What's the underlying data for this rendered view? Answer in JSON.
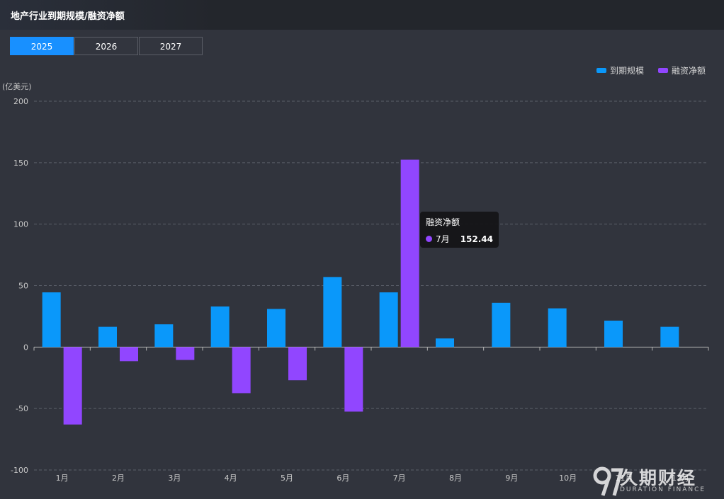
{
  "header": {
    "title": "地产行业到期规模/融资净额"
  },
  "tabs": [
    {
      "label": "2025",
      "active": true
    },
    {
      "label": "2026",
      "active": false
    },
    {
      "label": "2027",
      "active": false
    }
  ],
  "tooltip": {
    "series": "融资净额",
    "category": "7月",
    "value": "152.44"
  },
  "watermark": {
    "cn": "久期财经",
    "en": "DURATION FINANCE"
  },
  "colors": {
    "maturity": "#0a98fa",
    "net_financing": "#9146ff"
  },
  "chart_data": {
    "type": "bar",
    "title": "地产行业到期规模/融资净额",
    "ylabel": "(亿美元)",
    "ylim": [
      -100,
      200
    ],
    "yticks": [
      200,
      150,
      100,
      50,
      0,
      -50,
      -100
    ],
    "grid": true,
    "legend_position": "top-right",
    "categories": [
      "1月",
      "2月",
      "3月",
      "4月",
      "5月",
      "6月",
      "7月",
      "8月",
      "9月",
      "10月",
      "11月",
      "12月"
    ],
    "series": [
      {
        "name": "到期规模",
        "color": "#0a98fa",
        "values": [
          44.5,
          16.5,
          18.5,
          33,
          31,
          57,
          44.5,
          7,
          36,
          31.5,
          21.5,
          16.5
        ]
      },
      {
        "name": "融资净额",
        "color": "#9146ff",
        "values": [
          -63,
          -11.5,
          -10.5,
          -37.5,
          -27,
          -52.5,
          152.44,
          0,
          0,
          0,
          0,
          0
        ]
      }
    ]
  }
}
